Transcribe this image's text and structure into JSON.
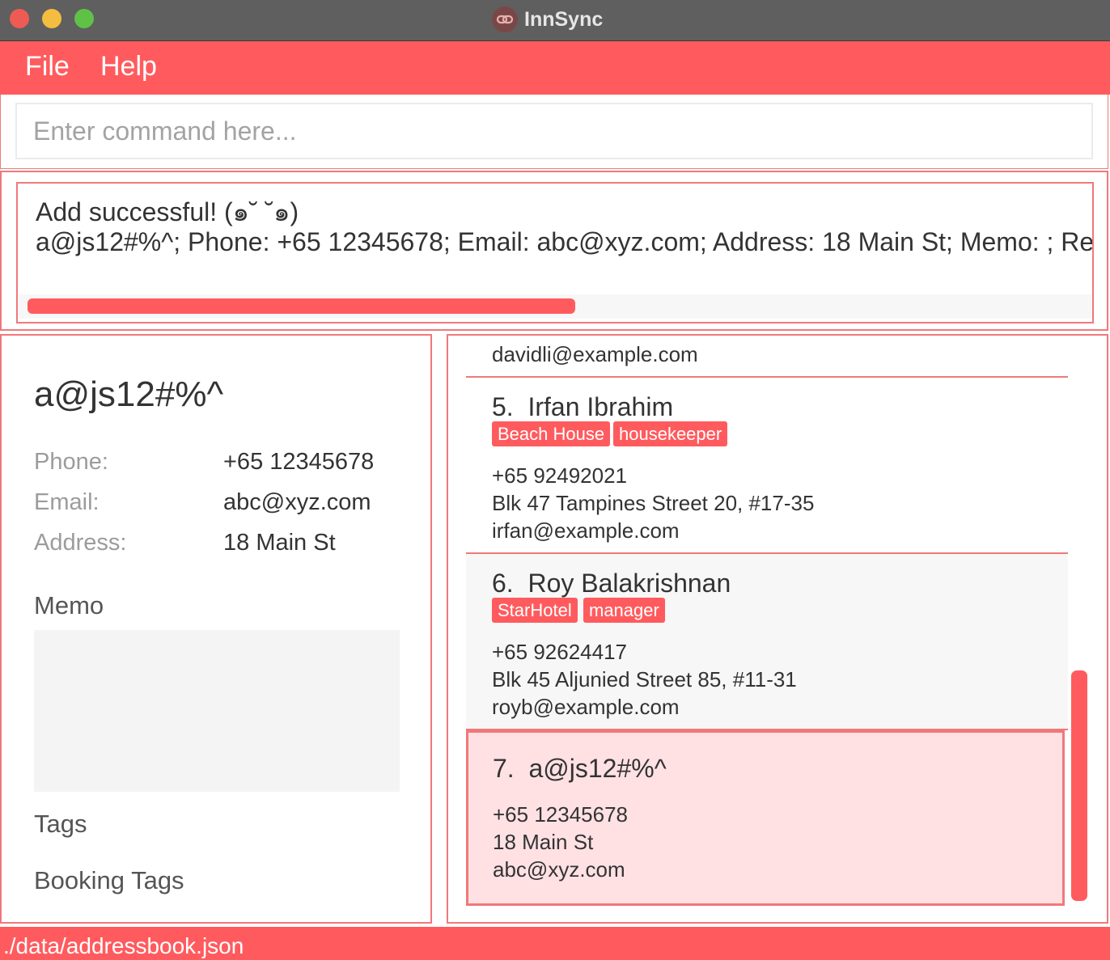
{
  "window": {
    "title": "InnSync"
  },
  "menu": {
    "file": "File",
    "help": "Help"
  },
  "command": {
    "placeholder": "Enter command here..."
  },
  "result": {
    "line1": "Add successful! (๑˘  ˘๑)",
    "line2": "a@js12#%^; Phone: +65 12345678; Email: abc@xyz.com; Address: 18 Main St; Memo: ; Re"
  },
  "detail": {
    "name": "a@js12#%^",
    "phone_label": "Phone:",
    "phone": "+65 12345678",
    "email_label": "Email:",
    "email": "abc@xyz.com",
    "address_label": "Address:",
    "address": "18 Main St",
    "memo_heading": "Memo",
    "tags_heading": "Tags",
    "booking_tags_heading": "Booking Tags"
  },
  "list": {
    "partial_email": "davidli@example.com",
    "persons": [
      {
        "index": "5.",
        "name": "Irfan Ibrahim",
        "tags": [
          "Beach House",
          "housekeeper"
        ],
        "phone": "+65 92492021",
        "address": "Blk 47 Tampines Street 20, #17-35",
        "email": "irfan@example.com"
      },
      {
        "index": "6.",
        "name": "Roy Balakrishnan",
        "tags": [
          "StarHotel",
          "manager"
        ],
        "phone": "+65 92624417",
        "address": "Blk 45 Aljunied Street 85, #11-31",
        "email": "royb@example.com"
      },
      {
        "index": "7.",
        "name": "a@js12#%^",
        "tags": [],
        "phone": "+65 12345678",
        "address": "18 Main St",
        "email": "abc@xyz.com"
      }
    ]
  },
  "status": {
    "path": "./data/addressbook.json"
  },
  "colors": {
    "accent": "#ff5b5e",
    "border": "#f1787a",
    "selected": "#ffe1e4",
    "titlebar": "#5f5f5f"
  }
}
